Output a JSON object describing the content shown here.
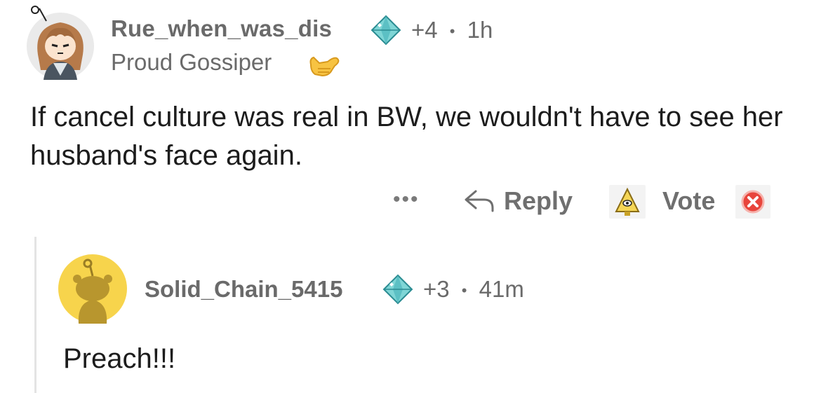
{
  "comment": {
    "username": "Rue_when_was_dis",
    "award_count": "+4",
    "separator": "•",
    "time": "1h",
    "flair": "Proud Gossiper",
    "text": "If cancel culture was real in BW, we wouldn't have to see her husband's face again.",
    "actions": {
      "more": "•••",
      "reply": "Reply",
      "vote": "Vote"
    }
  },
  "reply": {
    "username": "Solid_Chain_5415",
    "award_count": "+3",
    "separator": "•",
    "time": "41m",
    "text": "Preach!!!"
  },
  "icons": {
    "avatar_user": "cartoon-girl-avatar-icon",
    "avatar_reply": "default-snoo-avatar-icon",
    "award": "diamond-gem-icon",
    "flair": "call-me-hand-emoji-icon",
    "reply": "reply-arrow-icon",
    "upvote": "pyramid-eye-upvote-icon",
    "downvote": "red-x-downvote-icon"
  },
  "colors": {
    "meta_text": "#6a6a6a",
    "body_text": "#1c1c1c",
    "snoo_background": "#f7d44c",
    "gem": "#5fc6c9",
    "downvote": "#e8453c"
  }
}
